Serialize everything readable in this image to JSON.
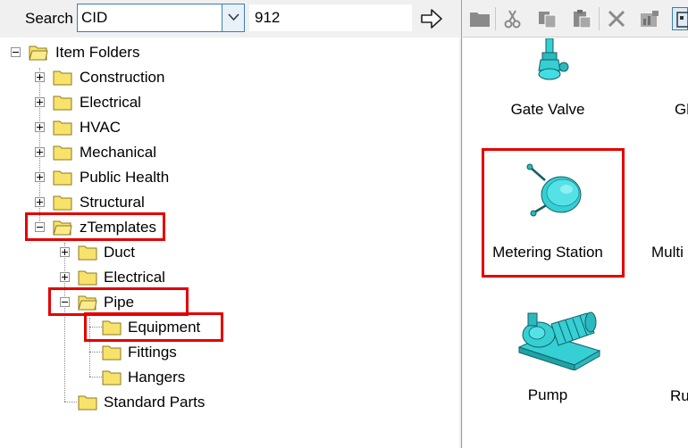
{
  "search": {
    "label": "Search",
    "field_value": "CID",
    "input_value": "912"
  },
  "tree": {
    "root": "Item Folders",
    "top_level": [
      "Construction",
      "Electrical",
      "HVAC",
      "Mechanical",
      "Public Health",
      "Structural",
      "zTemplates"
    ],
    "ztemplates_children": [
      "Duct",
      "Electrical",
      "Pipe",
      "Standard Parts"
    ],
    "pipe_children": [
      "Equipment",
      "Fittings",
      "Hangers"
    ]
  },
  "items": {
    "gate_valve": "Gate Valve",
    "metering_station": "Metering Station",
    "pump": "Pump",
    "partial_right": [
      "Gl",
      "Multi",
      "Ru"
    ]
  },
  "colors": {
    "highlight": "#e30000",
    "folder": "#f7e26b",
    "equipment_cyan": "#35cfd4"
  }
}
